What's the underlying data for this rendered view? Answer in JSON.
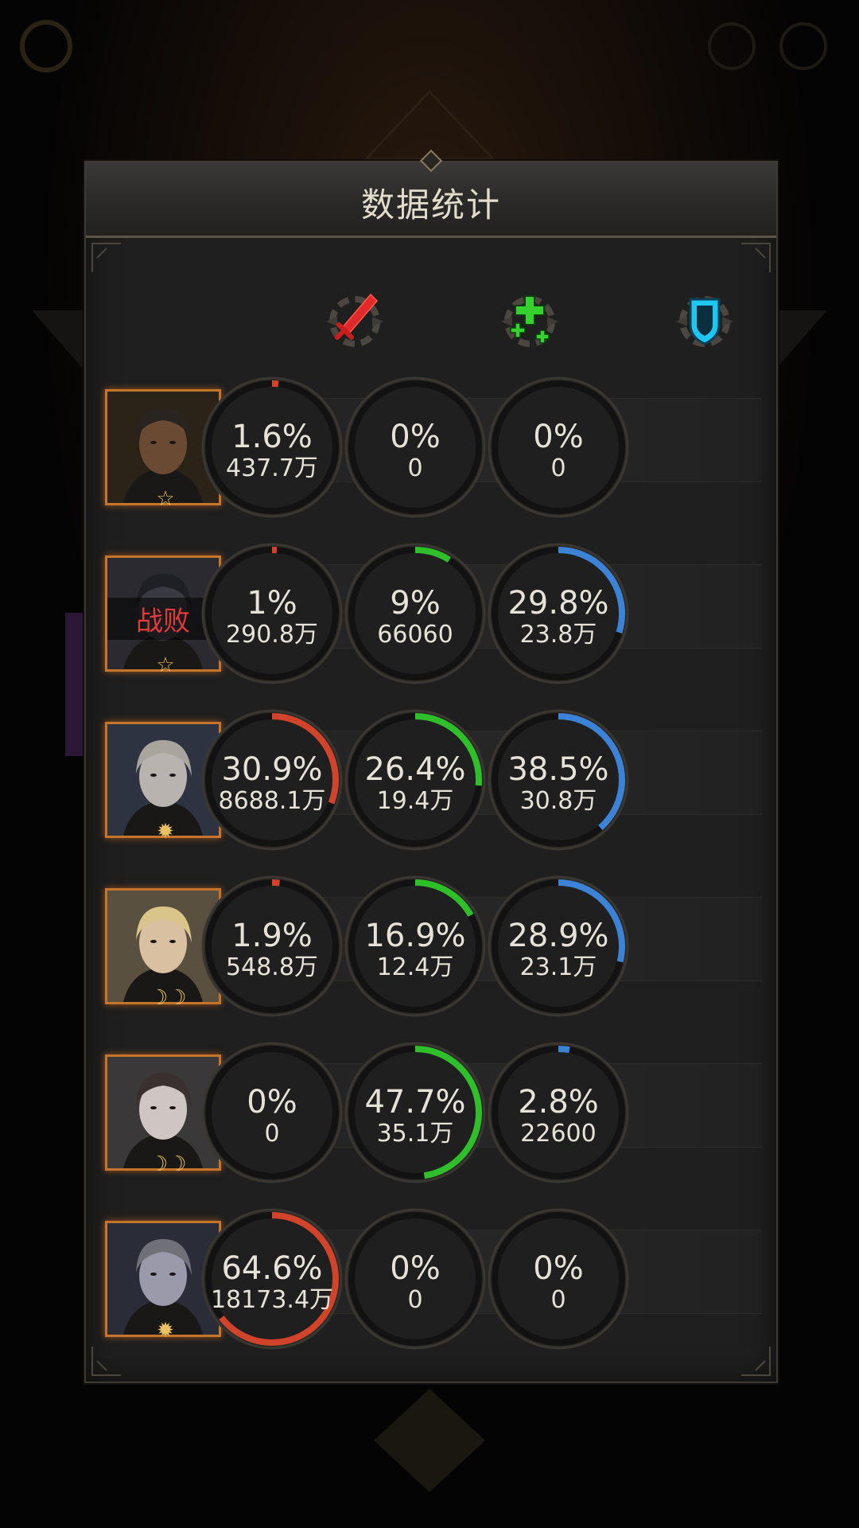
{
  "title": "数据统计",
  "colors": {
    "damage": "#d2432c",
    "heal": "#2fbf2a",
    "shield": "#3c82d6"
  },
  "columns": [
    {
      "name": "damage",
      "icon": "sword-icon"
    },
    {
      "name": "heal",
      "icon": "heal-cross-icon"
    },
    {
      "name": "shield",
      "icon": "shield-icon"
    }
  ],
  "heroes": [
    {
      "portrait": "bearded-warrior-portrait",
      "badge": "star",
      "badge_glyph": "☆",
      "defeated": "",
      "damage": {
        "pct": "1.6%",
        "amount": "437.7万",
        "value": 1.6
      },
      "heal": {
        "pct": "0%",
        "amount": "0",
        "value": 0
      },
      "shield": {
        "pct": "0%",
        "amount": "0",
        "value": 0
      }
    },
    {
      "portrait": "beast-portrait",
      "badge": "star",
      "badge_glyph": "☆",
      "defeated": "战败",
      "damage": {
        "pct": "1%",
        "amount": "290.8万",
        "value": 1
      },
      "heal": {
        "pct": "9%",
        "amount": "66060",
        "value": 9
      },
      "shield": {
        "pct": "29.8%",
        "amount": "23.8万",
        "value": 29.8
      }
    },
    {
      "portrait": "elf-sorceress-portrait",
      "badge": "sun",
      "badge_glyph": "✹",
      "defeated": "",
      "damage": {
        "pct": "30.9%",
        "amount": "8688.1万",
        "value": 30.9
      },
      "heal": {
        "pct": "26.4%",
        "amount": "19.4万",
        "value": 26.4
      },
      "shield": {
        "pct": "38.5%",
        "amount": "30.8万",
        "value": 38.5
      }
    },
    {
      "portrait": "blonde-elf-portrait",
      "badge": "moon",
      "badge_glyph": "☽☽",
      "defeated": "",
      "damage": {
        "pct": "1.9%",
        "amount": "548.8万",
        "value": 1.9
      },
      "heal": {
        "pct": "16.9%",
        "amount": "12.4万",
        "value": 16.9
      },
      "shield": {
        "pct": "28.9%",
        "amount": "23.1万",
        "value": 28.9
      }
    },
    {
      "portrait": "silver-priestess-portrait",
      "badge": "moon",
      "badge_glyph": "☽☽",
      "defeated": "",
      "damage": {
        "pct": "0%",
        "amount": "0",
        "value": 0
      },
      "heal": {
        "pct": "47.7%",
        "amount": "35.1万",
        "value": 47.7
      },
      "shield": {
        "pct": "2.8%",
        "amount": "22600",
        "value": 2.8
      }
    },
    {
      "portrait": "grey-haired-mage-portrait",
      "badge": "sun",
      "badge_glyph": "✹",
      "defeated": "",
      "damage": {
        "pct": "64.6%",
        "amount": "18173.4万",
        "value": 64.6
      },
      "heal": {
        "pct": "0%",
        "amount": "0",
        "value": 0
      },
      "shield": {
        "pct": "0%",
        "amount": "0",
        "value": 0
      }
    }
  ]
}
